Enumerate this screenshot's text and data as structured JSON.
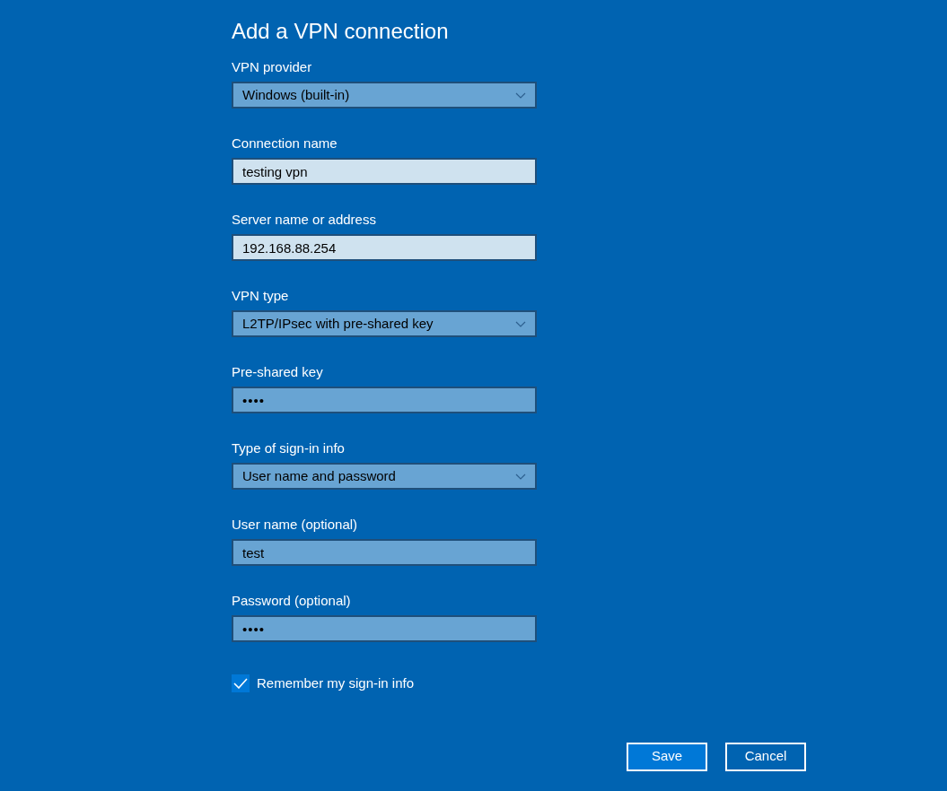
{
  "title": "Add a VPN connection",
  "fields": [
    {
      "label": "VPN provider",
      "kind": "dropdown",
      "value": "Windows (built-in)",
      "highlighted": false
    },
    {
      "label": "Connection name",
      "kind": "text",
      "value": "testing vpn",
      "highlighted": true
    },
    {
      "label": "Server name or address",
      "kind": "text",
      "value": "192.168.88.254",
      "highlighted": true
    },
    {
      "label": "VPN type",
      "kind": "dropdown",
      "value": "L2TP/IPsec with pre-shared key",
      "highlighted": false
    },
    {
      "label": "Pre-shared key",
      "kind": "password",
      "value": "••••",
      "highlighted": false
    },
    {
      "label": "Type of sign-in info",
      "kind": "dropdown",
      "value": "User name and password",
      "highlighted": false
    },
    {
      "label": "User name (optional)",
      "kind": "text",
      "value": "test",
      "highlighted": false
    },
    {
      "label": "Password (optional)",
      "kind": "password",
      "value": "••••",
      "highlighted": false
    }
  ],
  "remember": {
    "label": "Remember my sign-in info",
    "checked": true
  },
  "buttons": [
    {
      "label": "Save",
      "primary": true
    },
    {
      "label": "Cancel",
      "primary": false
    }
  ]
}
